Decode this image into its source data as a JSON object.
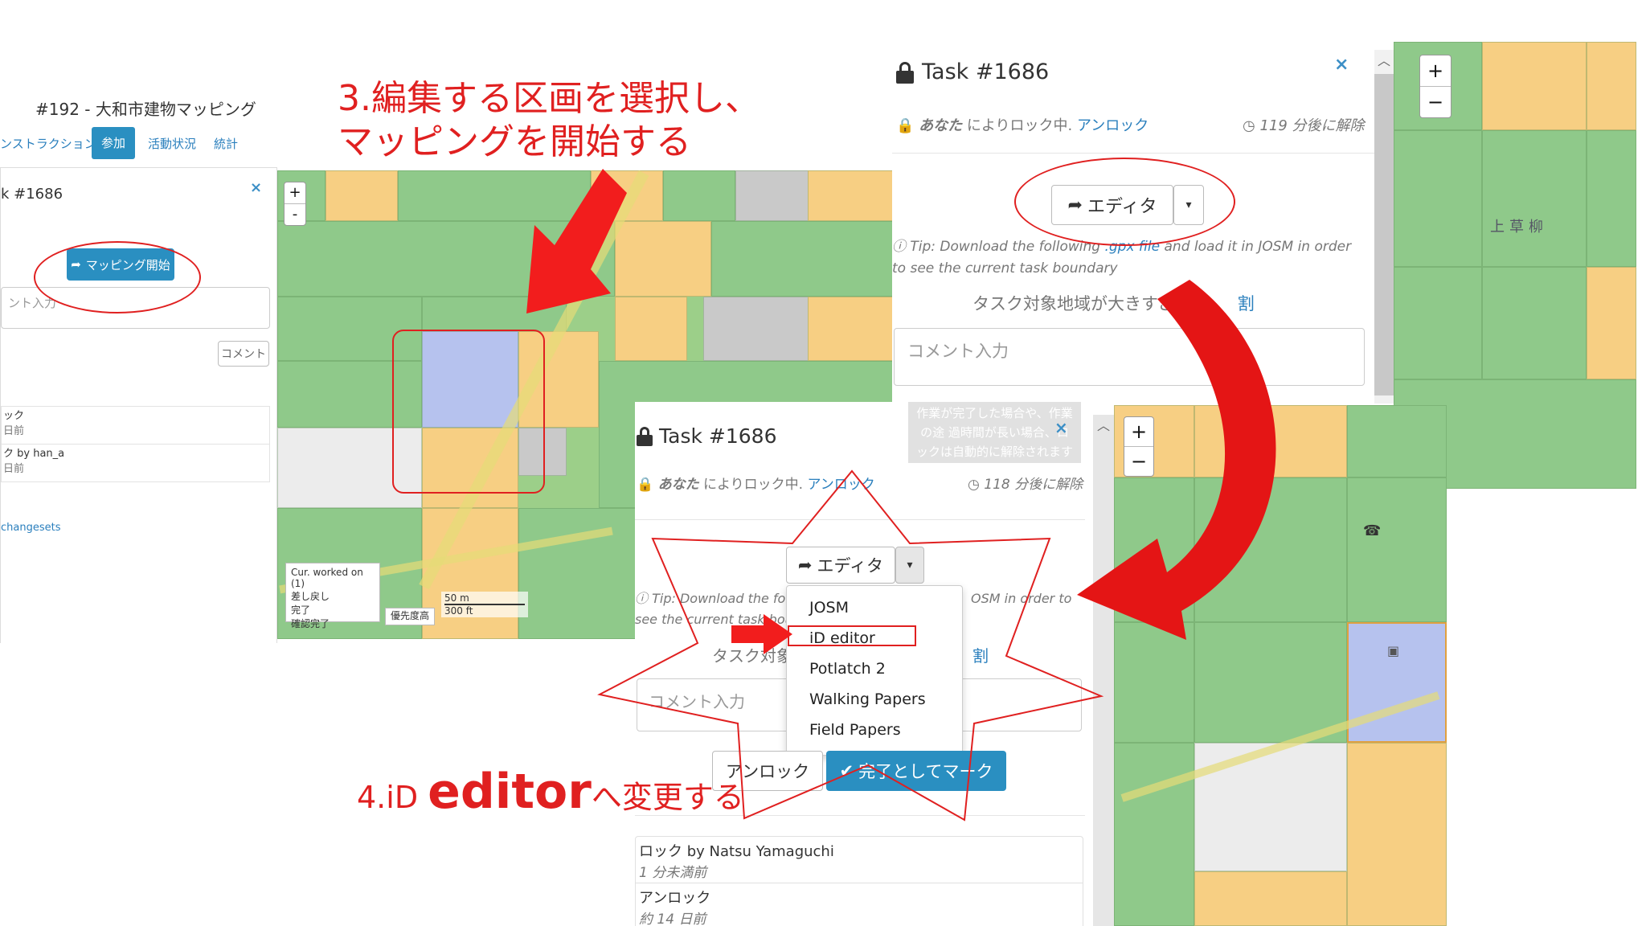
{
  "annotations": {
    "step3_line1": "3.編集する区画を選択し、",
    "step3_line2": "マッピングを開始する",
    "step4_prefix": "4.iD ",
    "step4_editor": "editor",
    "step4_suffix": "へ変更する"
  },
  "left_panel": {
    "project_title": "#192 - 大和市建物マッピング",
    "tabs": [
      {
        "label": "ンストラクション",
        "active": false
      },
      {
        "label": "参加",
        "active": true
      },
      {
        "label": "活動状況",
        "active": false
      },
      {
        "label": "統計",
        "active": false
      }
    ],
    "task_title": "k #1686",
    "close_symbol": "×",
    "start_mapping_button": "マッピング開始",
    "comment_placeholder": "ント入力",
    "comment_button": "コメント",
    "history": [
      {
        "action": "ック",
        "time": "日前"
      },
      {
        "action": "ク by han_a",
        "time": "日前"
      }
    ],
    "changesets_link": "changesets"
  },
  "left_map": {
    "zoom_in": "+",
    "zoom_out": "-",
    "legend": [
      "Cur. worked on (1)",
      "差し戻し",
      "完了",
      "確認完了"
    ],
    "priority_legend": "優先度高",
    "scale": [
      "50 m",
      "300 ft"
    ]
  },
  "top_right_panel": {
    "task_title": "Task #1686",
    "close_symbol": "×",
    "lock_by": "あなた",
    "lock_text": "によりロック中.",
    "unlock_link": "アンロック",
    "time_left": "119 分後に解除",
    "editor_button": "エディタ",
    "tip_prefix": "Tip: Download the following ",
    "tip_link": ".gpx file",
    "tip_suffix": " and load it in JOSM in order to see the current task boundary",
    "large_area_text": "タスク対象地域が大きすぎる",
    "split_link": "割",
    "comment_placeholder": "コメント入力"
  },
  "top_right_map": {
    "zoom_in": "+",
    "zoom_out": "−",
    "place_label": "上草柳"
  },
  "bottom_panel": {
    "task_title": "Task #1686",
    "close_symbol": "×",
    "tooltip": "作業が完了した場合や、作業の途 過時間が長い場合、ロックは自動的に解除されます",
    "lock_by": "あなた",
    "lock_text": "によりロック中.",
    "unlock_link": "アンロック",
    "time_left": "118 分後に解除",
    "editor_button": "エディタ",
    "tip_left": "Tip: Download the foll",
    "tip_right": "OSM in order to",
    "tip_line2": "see the current task boun",
    "large_area_text": "タスク対象",
    "split_link": "割",
    "comment_placeholder": "コメント入力",
    "editor_options": [
      "JOSM",
      "iD editor",
      "Potlatch 2",
      "Walking Papers",
      "Field Papers"
    ],
    "selected_option": "iD editor",
    "unlock_button": "アンロック",
    "done_button": "完了としてマーク",
    "history": [
      {
        "action": "ロック by Natsu Yamaguchi",
        "time": "1 分未満前"
      },
      {
        "action": "アンロック",
        "time": "約 14 日前"
      }
    ]
  },
  "bottom_right_map": {
    "zoom_in": "+",
    "zoom_out": "−"
  },
  "colors": {
    "annotation_red": "#e02020",
    "accent_blue": "#3c8fc6",
    "tab_active": "#2a8fc1",
    "done_button": "#2a8fc1",
    "grid_green": "#8fc98a",
    "grid_orange": "#f7cf83",
    "grid_blue": "#b6c2ee"
  },
  "icons": [
    "lock-icon",
    "clock-icon",
    "share-arrow-icon",
    "caret-down-icon",
    "info-icon",
    "checkmark-icon",
    "bus-stop-icon",
    "phone-icon"
  ]
}
